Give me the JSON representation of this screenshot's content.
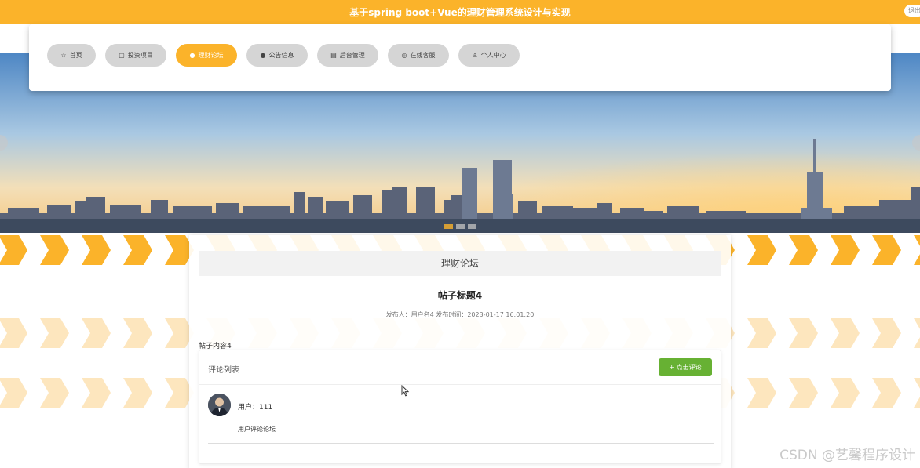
{
  "header": {
    "title": "基于spring boot+Vue的理财管理系统设计与实现",
    "logout_label": "退出"
  },
  "nav": {
    "items": [
      {
        "label": "首页",
        "icon": "star-icon",
        "active": false
      },
      {
        "label": "投资项目",
        "icon": "briefcase-icon",
        "active": false
      },
      {
        "label": "理财论坛",
        "icon": "dot-icon",
        "active": true
      },
      {
        "label": "公告信息",
        "icon": "info-icon",
        "active": false
      },
      {
        "label": "后台管理",
        "icon": "admin-icon",
        "active": false
      },
      {
        "label": "在线客服",
        "icon": "headset-icon",
        "active": false
      },
      {
        "label": "个人中心",
        "icon": "user-icon",
        "active": false
      }
    ]
  },
  "colors": {
    "accent": "#fbb32a",
    "button_green": "#67b133",
    "nav_inactive": "#d5d5d5"
  },
  "forum": {
    "section_title": "理财论坛",
    "post": {
      "title": "帖子标题4",
      "meta": "发布人：用户名4  发布时间：2023-01-17 16:01:20",
      "content": "帖子内容4"
    },
    "comments": {
      "title": "评论列表",
      "add_button_label": "+ 点击评论",
      "items": [
        {
          "user": "用户：111",
          "text": "用户评论论坛"
        }
      ]
    }
  },
  "watermark": "CSDN @艺馨程序设计"
}
